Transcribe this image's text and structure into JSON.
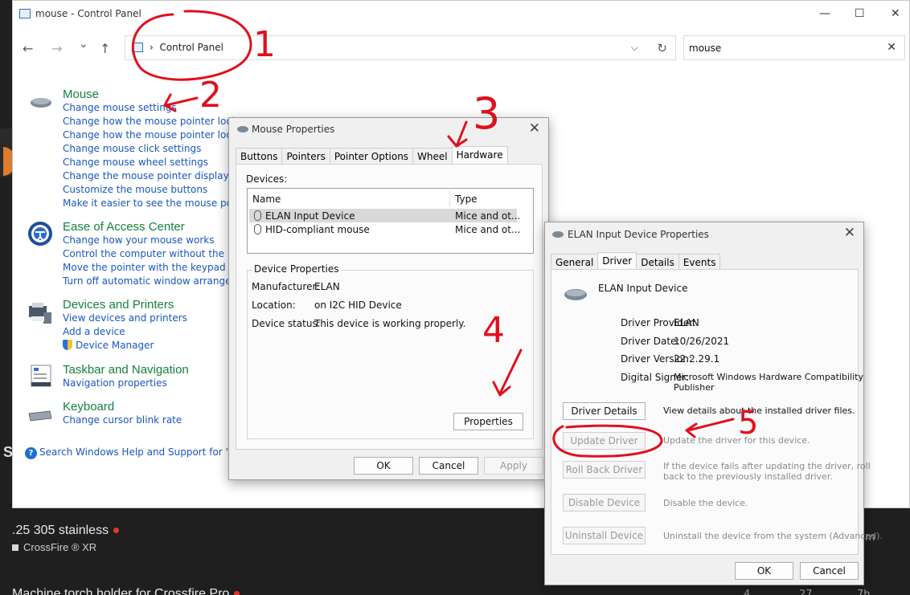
{
  "window": {
    "title": "mouse - Control Panel",
    "minimize": "—",
    "maximize": "☐",
    "close": "✕"
  },
  "nav": {
    "back": "←",
    "forward": "→",
    "recent": "⌄",
    "up": "↑"
  },
  "address": {
    "crumb": "Control Panel",
    "dropdown": "⌵",
    "refresh": "↻"
  },
  "search": {
    "value": "mouse",
    "clear": "✕"
  },
  "groups": [
    {
      "heading": "Mouse",
      "icon": "mouse-icon",
      "links": [
        "Change mouse settings",
        "Change how the mouse pointer looks",
        "Change how the mouse pointer looks w",
        "Change mouse click settings",
        "Change mouse wheel settings",
        "Change the mouse pointer display or sp",
        "Customize the mouse buttons",
        "Make it easier to see the mouse pointer"
      ]
    },
    {
      "heading": "Ease of Access Center",
      "icon": "ease-of-access-icon",
      "links": [
        "Change how your mouse works",
        "Control the computer without the mou",
        "Move the pointer with the keypad using",
        "Turn off automatic window arrangemen"
      ]
    },
    {
      "heading": "Devices and Printers",
      "icon": "devices-printers-icon",
      "links": [
        "View devices and printers",
        "Add a device",
        "Device Manager"
      ]
    },
    {
      "heading": "Taskbar and Navigation",
      "icon": "taskbar-icon",
      "links": [
        "Navigation properties"
      ]
    },
    {
      "heading": "Keyboard",
      "icon": "keyboard-icon",
      "links": [
        "Change cursor blink rate"
      ]
    }
  ],
  "help_link": "Search Windows Help and Support for \"mous",
  "mouse_props": {
    "title": "Mouse Properties",
    "tabs": [
      "Buttons",
      "Pointers",
      "Pointer Options",
      "Wheel",
      "Hardware"
    ],
    "active_tab": "Hardware",
    "devices_label": "Devices:",
    "col_name": "Name",
    "col_type": "Type",
    "devices": [
      {
        "name": "ELAN Input Device",
        "type": "Mice and ot..."
      },
      {
        "name": "HID-compliant mouse",
        "type": "Mice and ot..."
      }
    ],
    "device_properties_label": "Device Properties",
    "manufacturer_label": "Manufacturer:",
    "manufacturer": "ELAN",
    "location_label": "Location:",
    "location": "on I2C HID Device",
    "status_label": "Device status:",
    "status": "This device is working properly.",
    "properties_btn": "Properties",
    "ok": "OK",
    "cancel": "Cancel",
    "apply": "Apply"
  },
  "elan_props": {
    "title": "ELAN Input Device Properties",
    "tabs": [
      "General",
      "Driver",
      "Details",
      "Events"
    ],
    "active_tab": "Driver",
    "device_name": "ELAN Input Device",
    "provider_label": "Driver Provider:",
    "provider": "ELAN",
    "date_label": "Driver Date:",
    "date": "10/26/2021",
    "version_label": "Driver Version:",
    "version": "22.2.29.1",
    "signer_label": "Digital Signer:",
    "signer_1": "Microsoft Windows Hardware Compatibility",
    "signer_2": "Publisher",
    "driver_details_btn": "Driver Details",
    "driver_details_desc": "View details about the installed driver files.",
    "update_btn": "Update Driver",
    "update_desc": "Update the driver for this device.",
    "rollback_btn": "Roll Back Driver",
    "rollback_desc_1": "If the device fails after updating the driver, roll",
    "rollback_desc_2": "back to the previously installed driver.",
    "disable_btn": "Disable Device",
    "disable_desc": "Disable the device.",
    "uninstall_btn": "Uninstall Device",
    "uninstall_desc": "Uninstall the device from the system (Advanced).",
    "ok": "OK",
    "cancel": "Cancel"
  },
  "annotations": [
    "1",
    "2",
    "3",
    "4",
    "5"
  ],
  "background": {
    "post1_title": ".25 305 stainless",
    "post1_tag": "CrossFire ® XR",
    "post2_title": "Machine torch holder for Crossfire Pro",
    "side_s": "S",
    "col_m": "m",
    "stats": [
      "4",
      "27",
      "7h"
    ]
  },
  "colors": {
    "link": "#1a56c0",
    "heading": "#15803d",
    "annotation": "#e0101e",
    "background": "#1f1f1f"
  }
}
